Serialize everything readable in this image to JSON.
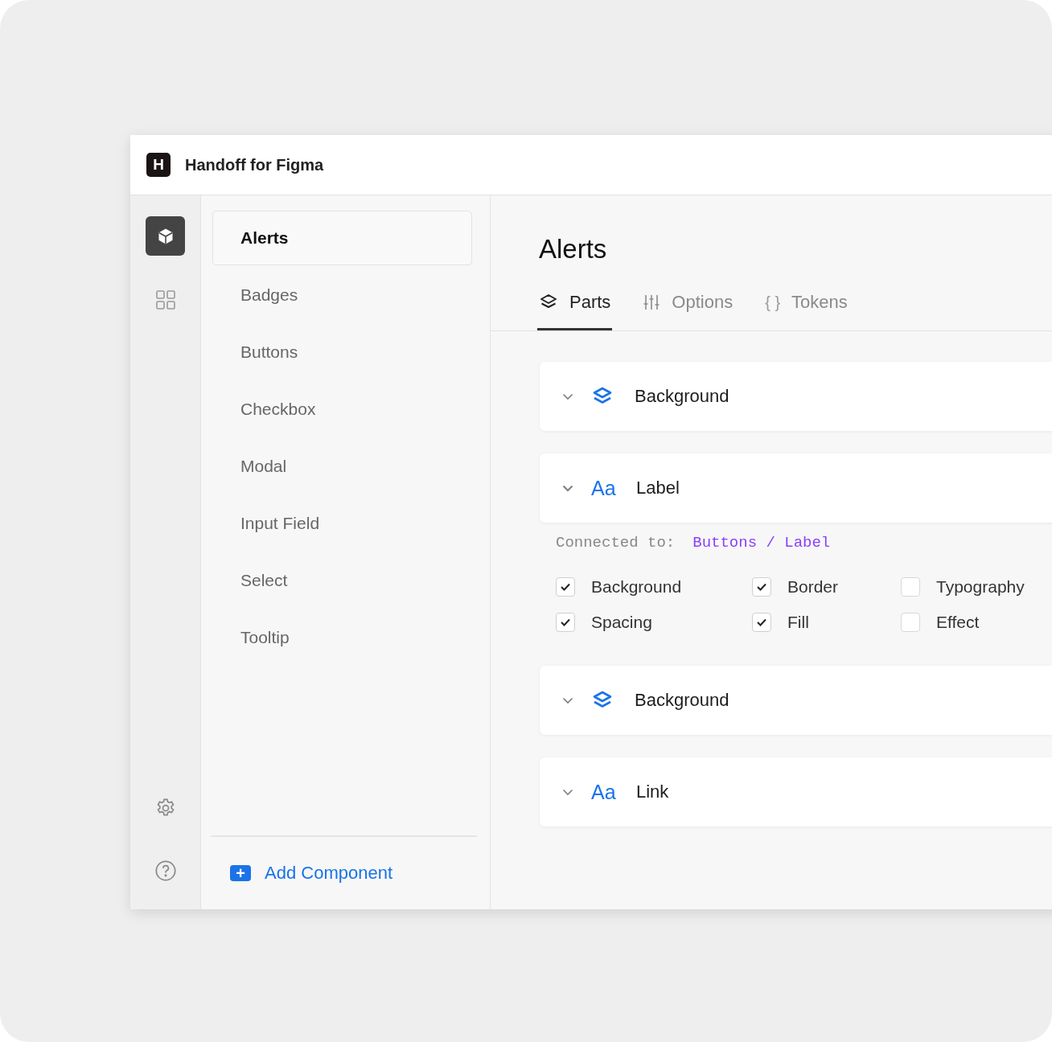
{
  "window": {
    "logo": "H",
    "title": "Handoff for Figma"
  },
  "rail": {
    "items": [
      {
        "kind": "cube",
        "selected": true
      },
      {
        "kind": "grid",
        "selected": false
      }
    ]
  },
  "components": [
    {
      "label": "Alerts",
      "selected": true
    },
    {
      "label": "Badges",
      "selected": false
    },
    {
      "label": "Buttons",
      "selected": false
    },
    {
      "label": "Checkbox",
      "selected": false
    },
    {
      "label": "Modal",
      "selected": false
    },
    {
      "label": "Input Field",
      "selected": false
    },
    {
      "label": "Select",
      "selected": false
    },
    {
      "label": "Tooltip",
      "selected": false
    }
  ],
  "add_button": {
    "icon": "+",
    "label": "Add Component"
  },
  "page_title": "Alerts",
  "tabs": [
    {
      "kind": "layers",
      "label": "Parts",
      "selected": true
    },
    {
      "kind": "sliders",
      "label": "Options",
      "selected": false
    },
    {
      "kind": "braces",
      "icon": "{ }",
      "label": "Tokens",
      "selected": false
    }
  ],
  "parts": [
    {
      "kind": "layers",
      "label": "Background",
      "expanded": false
    },
    {
      "kind": "text",
      "icon": "Aa",
      "label": "Label",
      "expanded": true,
      "connected_label": "Connected to:",
      "connected_value": "Buttons / Label",
      "options": [
        {
          "label": "Background",
          "checked": true
        },
        {
          "label": "Border",
          "checked": true
        },
        {
          "label": "Typography",
          "checked": false
        },
        {
          "label": "Spacing",
          "checked": true
        },
        {
          "label": "Fill",
          "checked": true
        },
        {
          "label": "Effect",
          "checked": false
        }
      ]
    },
    {
      "kind": "layers",
      "label": "Background",
      "expanded": false
    },
    {
      "kind": "text",
      "icon": "Aa",
      "label": "Link",
      "expanded": false
    }
  ]
}
